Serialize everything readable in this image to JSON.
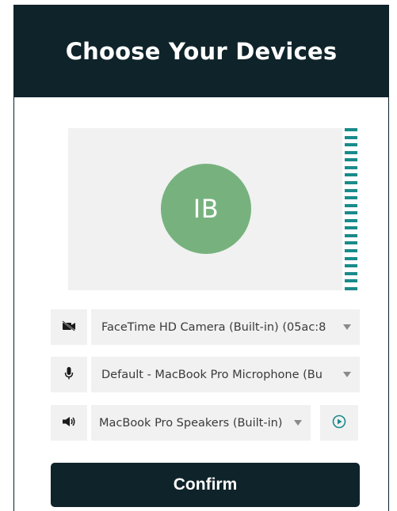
{
  "header": {
    "title": "Choose Your Devices"
  },
  "preview": {
    "avatar_initials": "IB",
    "level_meter_segments": 22
  },
  "devices": {
    "camera": {
      "icon": "video-camera-off-icon",
      "selected": "FaceTime HD Camera (Built-in) (05ac:8"
    },
    "microphone": {
      "icon": "microphone-icon",
      "selected": "Default - MacBook Pro Microphone (Bu"
    },
    "speaker": {
      "icon": "speaker-icon",
      "selected": "MacBook Pro Speakers (Built-in)",
      "test_icon": "play-circle-icon"
    }
  },
  "actions": {
    "confirm_label": "Confirm"
  },
  "colors": {
    "header_bg": "#0f232a",
    "avatar_bg": "#77b27e",
    "meter": "#1b8a8a",
    "control_bg": "#f1f1f1",
    "play_accent": "#1b8a8a"
  }
}
